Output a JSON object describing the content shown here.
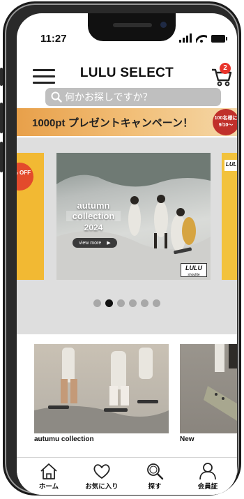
{
  "status_bar": {
    "time": "11:27"
  },
  "header": {
    "title": "LULU SELECT",
    "cart_count": "2"
  },
  "search": {
    "placeholder": "何かお探しですか？"
  },
  "campaign": {
    "text": "1000pt プレゼントキャンペーン！",
    "badge_line1": "100名様に",
    "badge_line2": "9/10〜"
  },
  "carousel": {
    "left_badge": "% OFF",
    "hero": {
      "title_line1": "autumn",
      "title_line2": "collection",
      "year": "2024",
      "button_label": "view more",
      "logo": "LULU",
      "logo_sub": "shoulite"
    },
    "right_tag": "LUL",
    "dots_count": 6,
    "active_dot": 1
  },
  "cards": [
    {
      "label": "autumu collection"
    },
    {
      "label": "New"
    }
  ],
  "tabs": [
    {
      "label": "ホーム",
      "icon": "home-icon"
    },
    {
      "label": "お気に入り",
      "icon": "heart-icon"
    },
    {
      "label": "探す",
      "icon": "search-icon"
    },
    {
      "label": "会員証",
      "icon": "member-icon"
    }
  ],
  "colors": {
    "campaign_start": "#e8a04a",
    "badge": "#e8332a",
    "dot_active": "#111111",
    "dot_inactive": "#a8a8a8"
  }
}
